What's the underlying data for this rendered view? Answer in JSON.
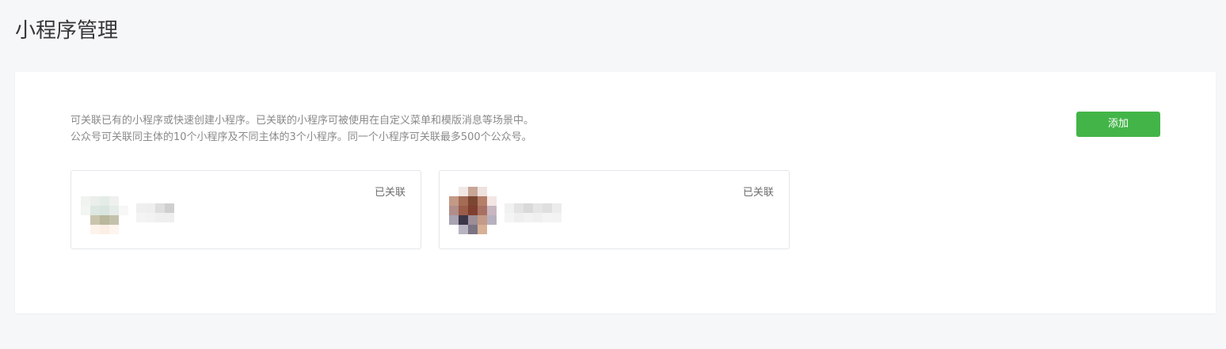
{
  "page": {
    "title": "小程序管理"
  },
  "description": {
    "line1": "可关联已有的小程序或快速创建小程序。已关联的小程序可被使用在自定义菜单和模版消息等场景中。",
    "line2": "公众号可关联同主体的10个小程序及不同主体的3个小程序。同一个小程序可关联最多500个公众号。"
  },
  "add_button": {
    "label": "添加"
  },
  "cards": [
    {
      "status": "已关联",
      "avatar": "blurred-avatar",
      "name": "blurred-name"
    },
    {
      "status": "已关联",
      "avatar": "blurred-avatar",
      "name": "blurred-name"
    }
  ],
  "colors": {
    "background": "#f6f7f9",
    "panel": "#ffffff",
    "accent_green": "#43b548",
    "text_primary": "#353535",
    "text_secondary": "#8a8a8a",
    "card_border": "#e4e6e9"
  },
  "mosaics": {
    "avatar1": [
      "#ffffff",
      "#ffffff",
      "#ffffff",
      "#ffffff",
      "#ffffff",
      "#f1f3f1",
      "#eaefeb",
      "#e4ece6",
      "#eef1ee",
      "#ffffff",
      "#f3f5f2",
      "#dde8e2",
      "#d9e5de",
      "#e6ece7",
      "#f6f7f6",
      "#ffffff",
      "#c9c5ad",
      "#b9b79c",
      "#c4c1ab",
      "#ffffff",
      "#ffffff",
      "#fdf3ea",
      "#fbeee5",
      "#fdf5ee",
      "#ffffff"
    ],
    "avatar2": [
      "#ffffff",
      "#f1e8e6",
      "#c8a596",
      "#eee2de",
      "#ffffff",
      "#c49a86",
      "#a46b55",
      "#7b4733",
      "#b47e68",
      "#f3e6e4",
      "#b18e8a",
      "#9a5d4a",
      "#803e2f",
      "#a77062",
      "#c8b6c0",
      "#a9a2b1",
      "#3c3649",
      "#9c8d96",
      "#c39b86",
      "#b7b0bf",
      "#ffffff",
      "#b9b4c2",
      "#7b7483",
      "#d7b096",
      "#ffffff"
    ],
    "name1": [
      "#efefef",
      "#eeeeee",
      "#dedede",
      "#cfcfcf",
      "#f4f4f4",
      "#f2f2f2",
      "#efefef",
      "#efefef"
    ],
    "name2": [
      "#f1f1f1",
      "#e3e3e3",
      "#d9d9d9",
      "#e5e5e5",
      "#dfdfdf",
      "#ececec",
      "#f4f4f4",
      "#efefef",
      "#f2f2f2",
      "#f0f0f0",
      "#f4f4f4",
      "#f3f3f3"
    ]
  }
}
